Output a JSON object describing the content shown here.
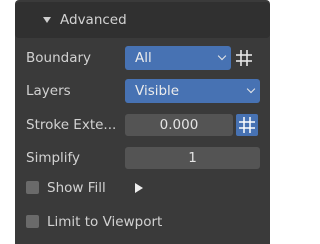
{
  "panel": {
    "title": "Advanced",
    "icons": {
      "expand": "triangle-down-icon",
      "grid": "grid-icon",
      "play": "play-icon"
    },
    "colors": {
      "accent": "#4772b3",
      "field": "#545454",
      "panel_bg": "#3a3a3a",
      "header_bg": "#303030"
    }
  },
  "rows": {
    "boundary": {
      "label": "Boundary",
      "value": "All"
    },
    "layers": {
      "label": "Layers",
      "value": "Visible"
    },
    "stroke_extension": {
      "label": "Stroke Exte...",
      "value": "0.000"
    },
    "simplify": {
      "label": "Simplify",
      "value": "1"
    },
    "show_fill": {
      "label": "Show Fill",
      "checked": false
    },
    "limit_to_viewport": {
      "label": "Limit to Viewport",
      "checked": false
    }
  }
}
